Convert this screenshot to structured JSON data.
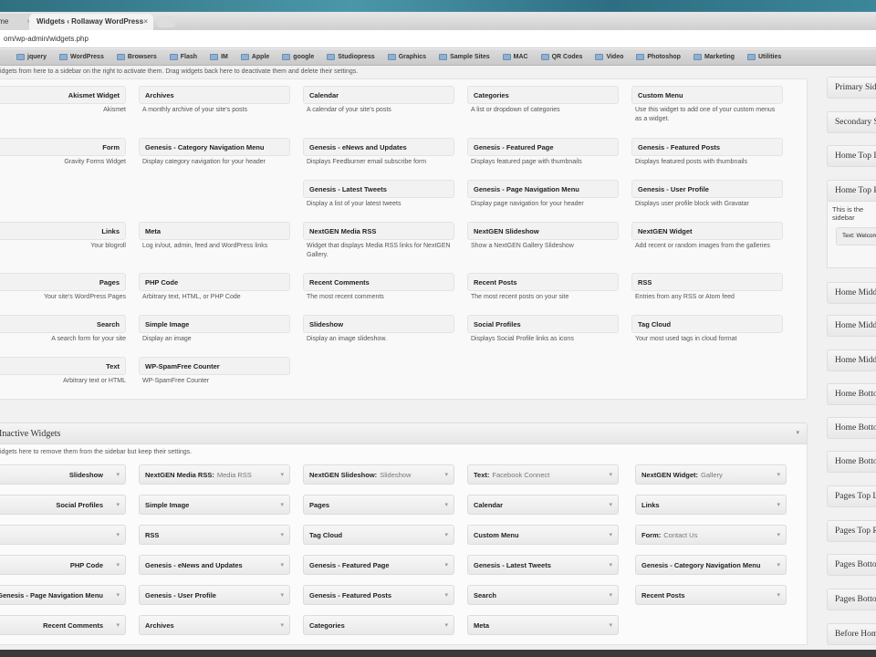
{
  "browser": {
    "tabs": [
      {
        "label": "Home"
      },
      {
        "label": "Widgets ‹ Rollaway WordPress"
      }
    ],
    "address": "om/wp-admin/widgets.php",
    "bookmarks": [
      "jquery",
      "WordPress",
      "Browsers",
      "Flash",
      "IM",
      "Apple",
      "google",
      "Studiopress",
      "Graphics",
      "Sample Sites",
      "MAC",
      "QR Codes",
      "Video",
      "Photoshop",
      "Marketing",
      "Utilities"
    ]
  },
  "available": {
    "intro": "idgets from here to a sidebar on the right to activate them. Drag widgets back here to deactivate them and delete their settings.",
    "rows": [
      [
        {
          "name": "Akismet Widget",
          "desc": "Akismet"
        },
        {
          "name": "Archives",
          "desc": "A monthly archive of your site's posts"
        },
        {
          "name": "Calendar",
          "desc": "A calendar of your site's posts"
        },
        {
          "name": "Categories",
          "desc": "A list or dropdown of categories"
        },
        {
          "name": "Custom Menu",
          "desc": "Use this widget to add one of your custom menus as a widget."
        }
      ],
      [
        {
          "name": "Form",
          "desc": "Gravity Forms Widget"
        },
        {
          "name": "Genesis - Category Navigation Menu",
          "desc": "Display category navigation for your header"
        },
        {
          "name": "Genesis - eNews and Updates",
          "desc": "Displays Feedburner email subscribe form"
        },
        {
          "name": "Genesis - Featured Page",
          "desc": "Displays featured page with thumbnails"
        },
        {
          "name": "Genesis - Featured Posts",
          "desc": "Displays featured posts with thumbnails"
        }
      ],
      [
        null,
        null,
        {
          "name": "Genesis - Latest Tweets",
          "desc": "Display a list of your latest tweets"
        },
        {
          "name": "Genesis - Page Navigation Menu",
          "desc": "Display page navigation for your header"
        },
        {
          "name": "Genesis - User Profile",
          "desc": "Displays user profile block with Gravatar"
        }
      ],
      [
        {
          "name": "Links",
          "desc": "Your blogroll"
        },
        {
          "name": "Meta",
          "desc": "Log in/out, admin, feed and WordPress links"
        },
        {
          "name": "NextGEN Media RSS",
          "desc": "Widget that displays Media RSS links for NextGEN Gallery."
        },
        {
          "name": "NextGEN Slideshow",
          "desc": "Show a NextGEN Gallery Slideshow"
        },
        {
          "name": "NextGEN Widget",
          "desc": "Add recent or random images from the galleries"
        }
      ],
      [
        {
          "name": "Pages",
          "desc": "Your site's WordPress Pages"
        },
        {
          "name": "PHP Code",
          "desc": "Arbitrary text, HTML, or PHP Code"
        },
        {
          "name": "Recent Comments",
          "desc": "The most recent comments"
        },
        {
          "name": "Recent Posts",
          "desc": "The most recent posts on your site"
        },
        {
          "name": "RSS",
          "desc": "Entries from any RSS or Atom feed"
        }
      ],
      [
        {
          "name": "Search",
          "desc": "A search form for your site"
        },
        {
          "name": "Simple Image",
          "desc": "Display an image"
        },
        {
          "name": "Slideshow",
          "desc": "Display an image slideshow."
        },
        {
          "name": "Social Profiles",
          "desc": "Displays Social Profile links as icons"
        },
        {
          "name": "Tag Cloud",
          "desc": "Your most used tags in cloud format"
        }
      ],
      [
        {
          "name": "Text",
          "desc": "Arbitrary text or HTML"
        },
        {
          "name": "WP-SpamFree Counter",
          "desc": "WP-SpamFree Counter"
        },
        null,
        null,
        null
      ]
    ]
  },
  "inactive": {
    "title": "Inactive Widgets",
    "desc": "idgets here to remove them from the sidebar but keep their settings.",
    "rows": [
      [
        {
          "name": "Slideshow"
        },
        {
          "name": "NextGEN Media RSS:",
          "sub": "Media RSS"
        },
        {
          "name": "NextGEN Slideshow:",
          "sub": "Slideshow"
        },
        {
          "name": "Text:",
          "sub": "Facebook Connect"
        },
        {
          "name": "NextGEN Widget:",
          "sub": "Gallery"
        }
      ],
      [
        {
          "name": "Social Profiles"
        },
        {
          "name": "Simple Image"
        },
        {
          "name": "Pages"
        },
        {
          "name": "Calendar"
        },
        {
          "name": "Links"
        }
      ],
      [
        {
          "name": ""
        },
        {
          "name": "RSS"
        },
        {
          "name": "Tag Cloud"
        },
        {
          "name": "Custom Menu"
        },
        {
          "name": "Form:",
          "sub": "Contact Us"
        }
      ],
      [
        {
          "name": "PHP Code"
        },
        {
          "name": "Genesis - eNews and Updates"
        },
        {
          "name": "Genesis - Featured Page"
        },
        {
          "name": "Genesis - Latest Tweets"
        },
        {
          "name": "Genesis - Category Navigation Menu"
        }
      ],
      [
        {
          "name": "Genesis - Page Navigation Menu"
        },
        {
          "name": "Genesis - User Profile"
        },
        {
          "name": "Genesis - Featured Posts"
        },
        {
          "name": "Search"
        },
        {
          "name": "Recent Posts"
        }
      ],
      [
        {
          "name": "Recent Comments"
        },
        {
          "name": "Archives"
        },
        {
          "name": "Categories"
        },
        {
          "name": "Meta"
        },
        null
      ]
    ]
  },
  "sidebars": {
    "items": [
      "Primary Sidebar",
      "Secondary Sidebar",
      "Home Top Left",
      "Home Top Right",
      "Home Middle Left",
      "Home Middle Middle",
      "Home Middle Right",
      "Home Bottom Left",
      "Home Bottom Middle",
      "Home Bottom Right",
      "Pages Top Left",
      "Pages Top Right",
      "Pages Bottom Left",
      "Pages Bottom Right",
      "Before Home"
    ],
    "expanded_desc": "This is the sidebar",
    "expanded_widget": "Text: Welcome"
  }
}
